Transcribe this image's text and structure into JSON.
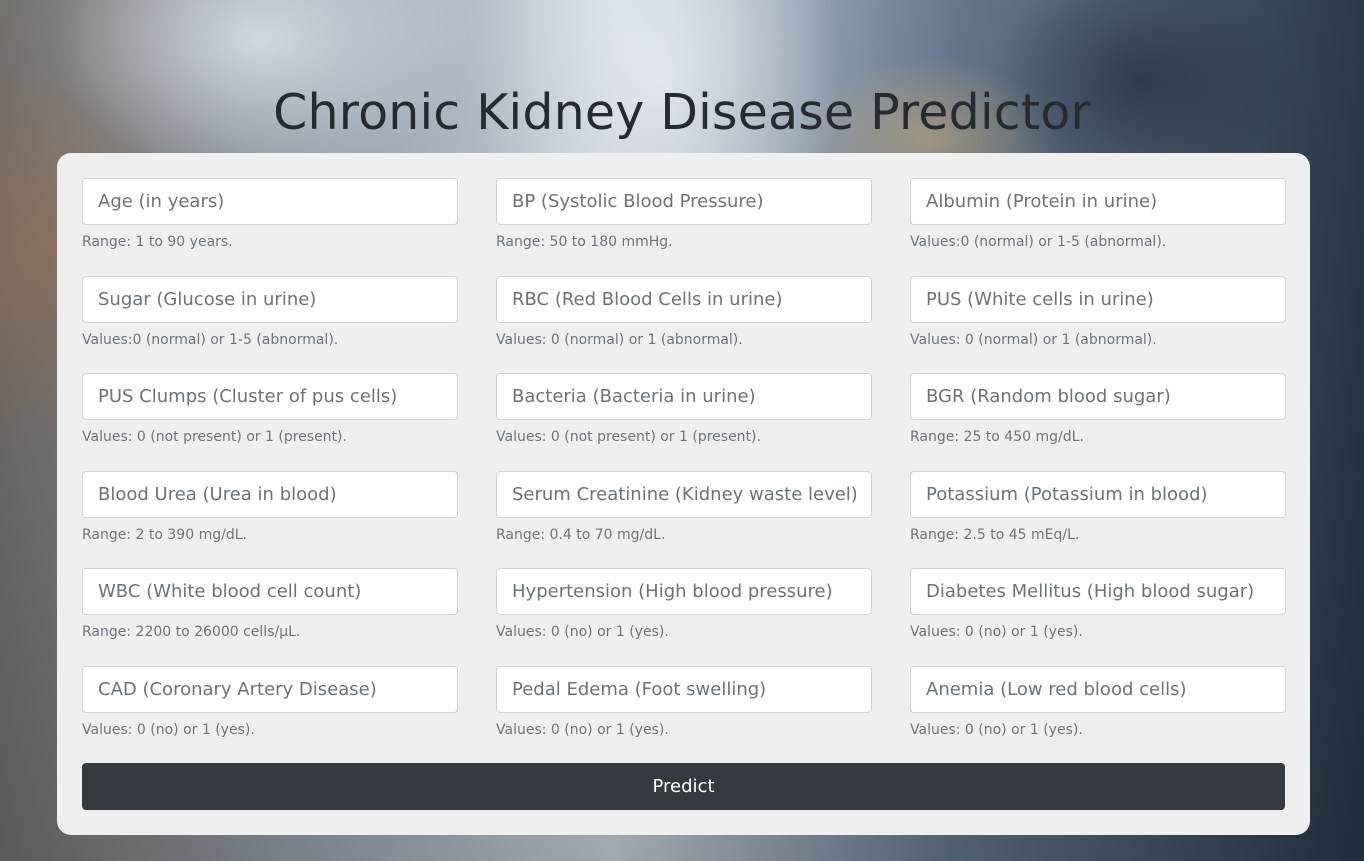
{
  "title": "Chronic Kidney Disease Predictor",
  "fields": [
    {
      "placeholder": "Age (in years)",
      "hint": "Range: 1 to 90 years."
    },
    {
      "placeholder": "BP (Systolic Blood Pressure)",
      "hint": "Range: 50 to 180 mmHg."
    },
    {
      "placeholder": "Albumin (Protein in urine)",
      "hint": "Values:0 (normal) or 1-5 (abnormal)."
    },
    {
      "placeholder": "Sugar (Glucose in urine)",
      "hint": "Values:0 (normal) or 1-5 (abnormal)."
    },
    {
      "placeholder": "RBC (Red Blood Cells in urine)",
      "hint": "Values: 0 (normal) or 1 (abnormal)."
    },
    {
      "placeholder": "PUS (White cells in urine)",
      "hint": "Values: 0 (normal) or 1 (abnormal)."
    },
    {
      "placeholder": "PUS Clumps (Cluster of pus cells)",
      "hint": "Values: 0 (not present) or 1 (present)."
    },
    {
      "placeholder": "Bacteria (Bacteria in urine)",
      "hint": "Values: 0 (not present) or 1 (present)."
    },
    {
      "placeholder": "BGR (Random blood sugar)",
      "hint": "Range: 25 to 450 mg/dL."
    },
    {
      "placeholder": "Blood Urea (Urea in blood)",
      "hint": "Range: 2 to 390 mg/dL."
    },
    {
      "placeholder": "Serum Creatinine (Kidney waste level)",
      "hint": "Range: 0.4 to 70 mg/dL."
    },
    {
      "placeholder": "Potassium (Potassium in blood)",
      "hint": "Range: 2.5 to 45 mEq/L."
    },
    {
      "placeholder": "WBC (White blood cell count)",
      "hint": "Range: 2200 to 26000 cells/µL."
    },
    {
      "placeholder": "Hypertension (High blood pressure)",
      "hint": "Values: 0 (no) or 1 (yes)."
    },
    {
      "placeholder": "Diabetes Mellitus (High blood sugar)",
      "hint": "Values: 0 (no) or 1 (yes)."
    },
    {
      "placeholder": "CAD (Coronary Artery Disease)",
      "hint": "Values: 0 (no) or 1 (yes)."
    },
    {
      "placeholder": "Pedal Edema (Foot swelling)",
      "hint": "Values: 0 (no) or 1 (yes)."
    },
    {
      "placeholder": "Anemia (Low red blood cells)",
      "hint": "Values: 0 (no) or 1 (yes)."
    }
  ],
  "predict_label": "Predict",
  "colors": {
    "card": "#efefef",
    "button": "#343a40",
    "title": "#262b31",
    "hint": "#6c757d"
  }
}
